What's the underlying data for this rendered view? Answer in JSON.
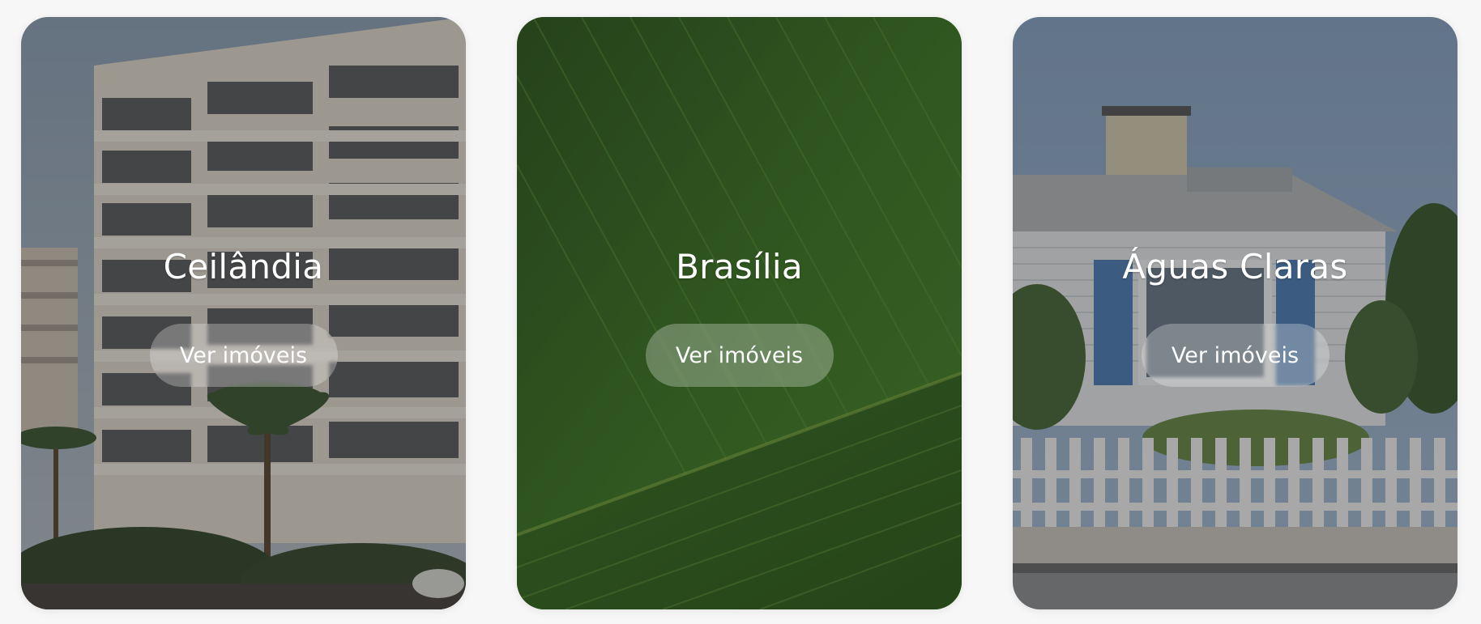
{
  "cities": [
    {
      "name": "Ceilândia",
      "button_label": "Ver imóveis",
      "image": "apartment-buildings-palm-trees"
    },
    {
      "name": "Brasília",
      "button_label": "Ver imóveis",
      "image": "aerial-green-fields"
    },
    {
      "name": "Águas Claras",
      "button_label": "Ver imóveis",
      "image": "house-white-picket-fence"
    }
  ],
  "colors": {
    "page_background": "#f7f7f7",
    "card_text": "#ffffff",
    "button_background": "rgba(255,255,255,0.28)",
    "card_overlay": "rgba(20,20,20,0.34)"
  }
}
